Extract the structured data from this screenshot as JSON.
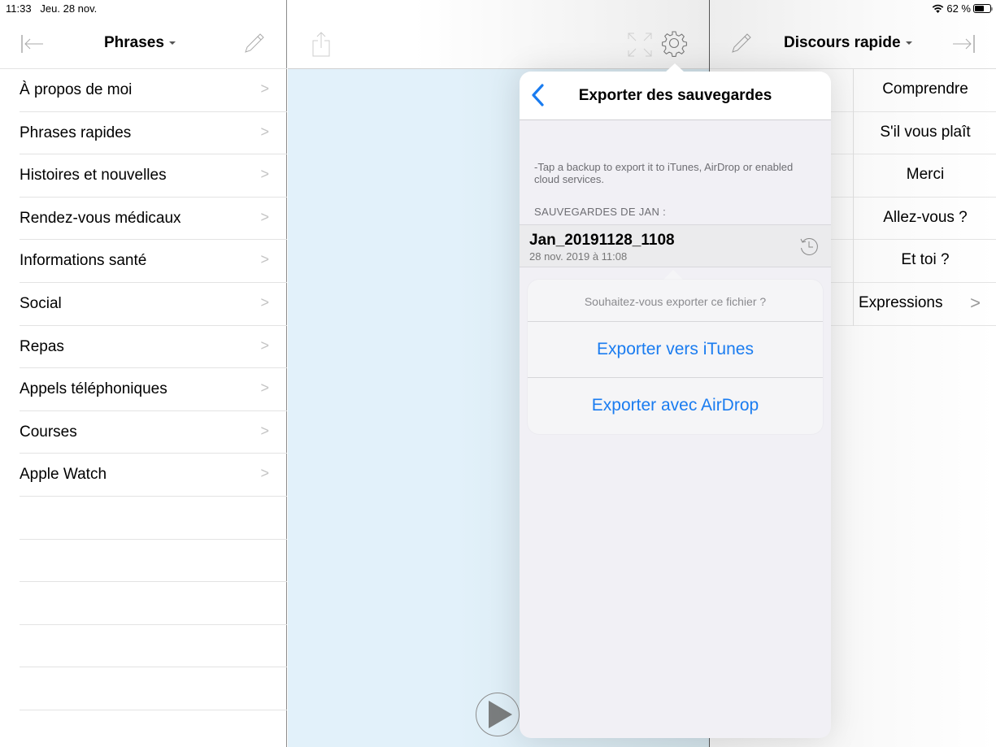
{
  "status_bar": {
    "time": "11:33",
    "date": "Jeu. 28 nov.",
    "battery_text": "62 %",
    "battery_level": 0.62,
    "wifi_icon": "wifi-icon"
  },
  "left_panel": {
    "title": "Phrases",
    "collapse_icon": "collapse-left-icon",
    "edit_icon": "pencil-icon",
    "items": [
      {
        "label": "À propos de moi"
      },
      {
        "label": "Phrases rapides"
      },
      {
        "label": "Histoires et nouvelles"
      },
      {
        "label": "Rendez-vous médicaux"
      },
      {
        "label": "Informations santé"
      },
      {
        "label": "Social"
      },
      {
        "label": "Repas"
      },
      {
        "label": "Appels téléphoniques"
      },
      {
        "label": "Courses"
      },
      {
        "label": "Apple Watch"
      }
    ],
    "chevron": ">"
  },
  "middle_panel": {
    "share_icon": "share-icon",
    "expand_icon": "expand-icon",
    "settings_icon": "gear-icon",
    "play_icon": "play-icon"
  },
  "right_panel": {
    "title": "Discours rapide",
    "edit_icon": "pencil-icon",
    "expand_icon": "collapse-right-icon",
    "items": [
      {
        "label": "Comprendre"
      },
      {
        "label": "S'il vous plaît"
      },
      {
        "label": "Merci"
      },
      {
        "label": "Allez-vous ?"
      },
      {
        "label": "Et toi ?"
      },
      {
        "label": "Expressions",
        "has_chevron": true
      }
    ],
    "chevron": ">"
  },
  "popover": {
    "title": "Exporter des sauvegardes",
    "back_icon": "back-chevron-icon",
    "info_text": "-Tap a backup to export it to iTunes, AirDrop or enabled cloud services.",
    "section_header": "SAUVEGARDES DE JAN :",
    "backups": [
      {
        "name": "Jan_20191128_1108",
        "date": "28 nov. 2019 à 11:08",
        "icon": "restore-history-icon"
      }
    ],
    "action_sheet": {
      "title": "Souhaitez-vous exporter ce fichier ?",
      "actions": [
        {
          "label": "Exporter vers iTunes"
        },
        {
          "label": "Exporter avec AirDrop"
        }
      ]
    }
  },
  "colors": {
    "accent": "#1a7cf0",
    "secondary_text": "#6d6d72",
    "separator": "#e3e3e3"
  }
}
